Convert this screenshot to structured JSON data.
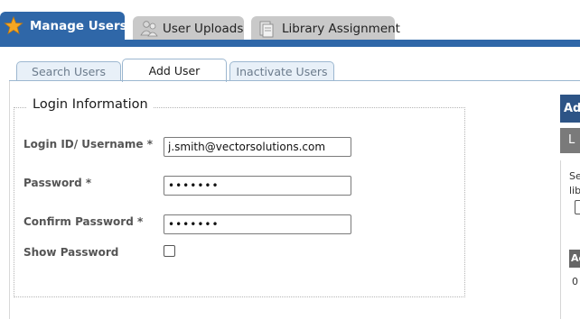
{
  "tabs": [
    {
      "label": "Manage Users",
      "icon": "star-icon",
      "active": true
    },
    {
      "label": "User Uploads",
      "icon": "users-icon",
      "active": false
    },
    {
      "label": "Library Assignment",
      "icon": "library-icon",
      "active": false
    }
  ],
  "subtabs": [
    {
      "label": "Search Users",
      "active": false
    },
    {
      "label": "Add User",
      "active": true
    },
    {
      "label": "Inactivate Users",
      "active": false
    }
  ],
  "form": {
    "legend": "Login Information",
    "username_label": "Login ID/ Username *",
    "username_value": "j.smith@vectorsolutions.com",
    "password_label": "Password *",
    "password_value": "•••••••",
    "confirm_label": "Confirm Password *",
    "confirm_value": "•••••••",
    "show_password_label": "Show Password",
    "show_password_checked": false
  },
  "right_panel": {
    "header": "Ad",
    "button": "L",
    "text1": "Se",
    "text2": "lib",
    "th": "Ac",
    "row_value": "0"
  },
  "colors": {
    "accent": "#2f67a8",
    "tab_inactive": "#c9c9c9",
    "panel_header": "#2d5486"
  }
}
